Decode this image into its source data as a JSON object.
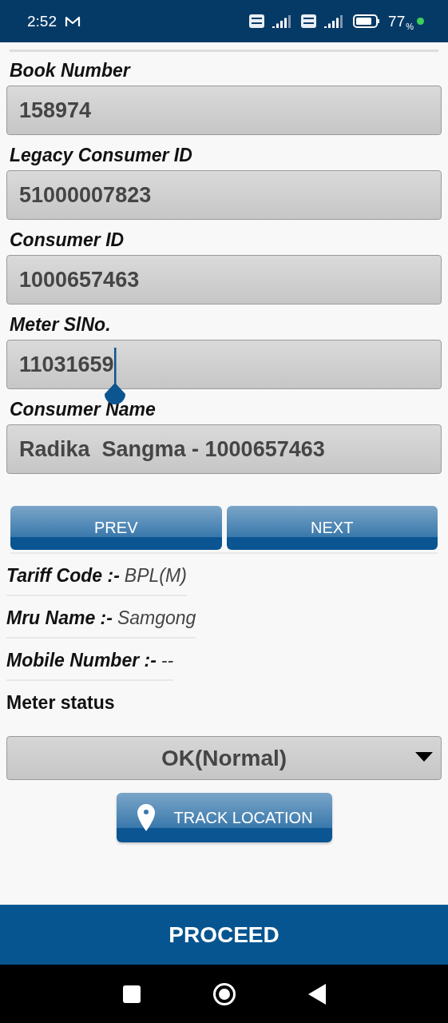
{
  "status_bar": {
    "time": "2:52",
    "battery": "77",
    "battery_unit": "%"
  },
  "fields": [
    {
      "label": "Book Number",
      "value": "158974",
      "focused": false
    },
    {
      "label": "Legacy Consumer ID",
      "value": "51000007823",
      "focused": false
    },
    {
      "label": "Consumer ID",
      "value": "1000657463",
      "focused": false
    },
    {
      "label": "Meter SlNo.",
      "value": "11031659",
      "focused": true
    },
    {
      "label": "Consumer Name",
      "value": "Radika  Sangma - 1000657463",
      "focused": false
    }
  ],
  "nav_buttons": [
    "PREV",
    "NEXT"
  ],
  "details": [
    {
      "label": "Tariff Code :-",
      "value": "BPL(M)"
    },
    {
      "label": "Mru Name :-",
      "value": "Samgong"
    },
    {
      "label": "Mobile Number :-",
      "value": "--"
    }
  ],
  "meter_status": {
    "label": "Meter status",
    "value": "OK(Normal)"
  },
  "track_button": "TRACK LOCATION",
  "proceed_button": "PROCEED"
}
